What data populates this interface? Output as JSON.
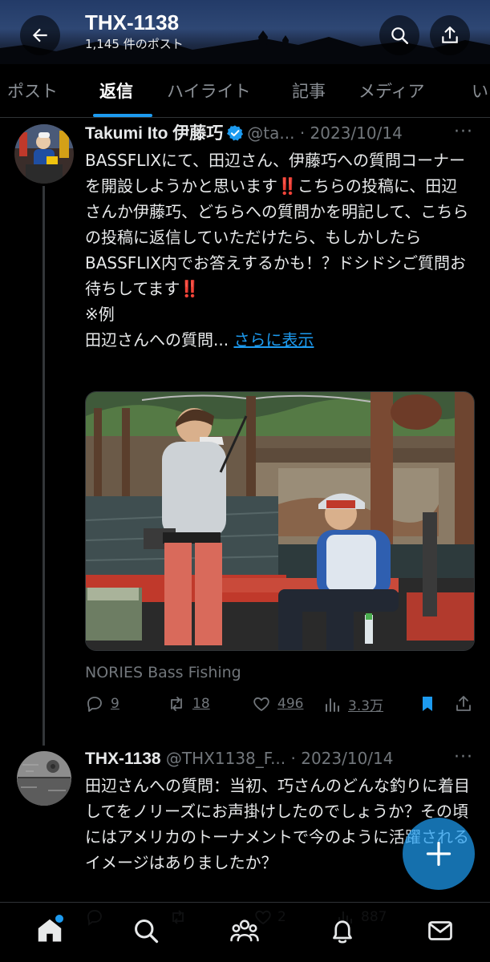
{
  "header": {
    "title": "THX-1138",
    "post_count": "1,145 件のポスト",
    "back_icon": "arrow-left-icon",
    "search_icon": "search-icon",
    "share_icon": "share-icon"
  },
  "tabs": [
    {
      "label": "ポスト",
      "active": false
    },
    {
      "label": "返信",
      "active": true
    },
    {
      "label": "ハイライト",
      "active": false
    },
    {
      "label": "記事",
      "active": false
    },
    {
      "label": "メディア",
      "active": false
    },
    {
      "label": "い",
      "active": false
    }
  ],
  "tweets": [
    {
      "name": "Takumi Ito 伊藤巧",
      "verified": true,
      "handle": "@ta...",
      "date": "· 2023/10/14",
      "text": "BASSFLIXにて、田辺さん、伊藤巧への質問コーナーを開設しようかと思います‼️こちらの投稿に、田辺さんか伊藤巧、どちらへの質問かを明記して、こちらの投稿に返信していただけたら、もしかしたらBASSFLIX内でお答えするかも！？ドシドシご質問お待ちしてます‼️",
      "line_example": "※例",
      "line_question": "田辺さんへの質問...",
      "show_more": "さらに表示",
      "media_caption": "NORIES Bass Fishing",
      "actions": {
        "replies": "9",
        "reposts": "18",
        "likes": "496",
        "views": "3.3万"
      }
    },
    {
      "name": "THX-1138",
      "handle": "@THX1138_F...",
      "date": "· 2023/10/14",
      "text": "田辺さんへの質問：当初、巧さんのどんな釣りに着目してをノリーズにお声掛けしたのでしょうか？その頃にはアメリカのトーナメントで今のように活躍されるイメージはありましたか？",
      "actions": {
        "likes": "2",
        "views": "887"
      }
    }
  ],
  "colors": {
    "accent": "#1d9bf0",
    "muted": "#71767b",
    "text": "#e7e9ea",
    "background": "#000000"
  },
  "bottom_nav": [
    "home-icon",
    "search-icon",
    "communities-icon",
    "notifications-icon",
    "messages-icon"
  ],
  "fab_icon": "compose-plus-icon"
}
